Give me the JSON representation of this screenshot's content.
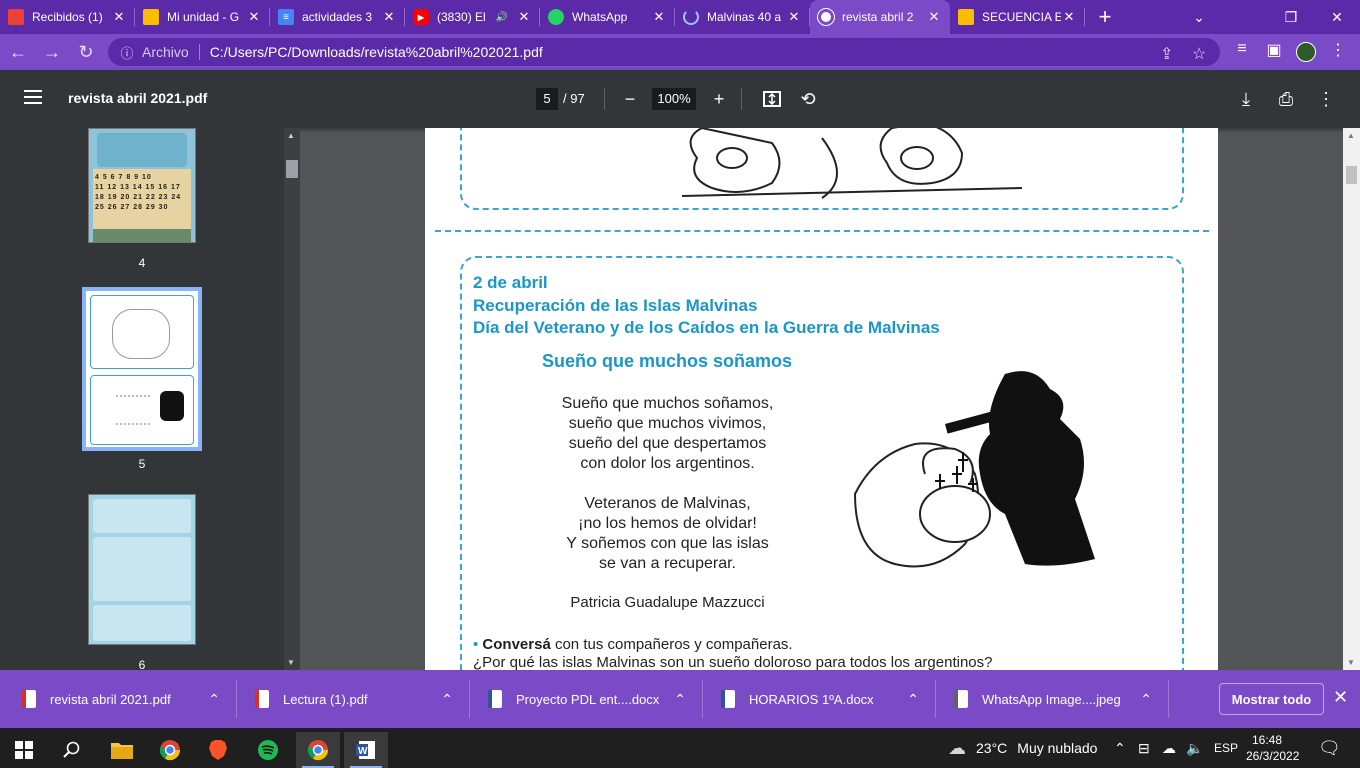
{
  "tabs": [
    {
      "label": "Recibidos (1)",
      "icon": "gmail-icon",
      "color": "#ea4335",
      "active": false
    },
    {
      "label": "Mi unidad - G",
      "icon": "drive-icon",
      "color": "#fbbc04",
      "active": false
    },
    {
      "label": "actividades 3",
      "icon": "docs-icon",
      "color": "#4285f4",
      "active": false
    },
    {
      "label": "(3830) El",
      "icon": "youtube-icon",
      "color": "#ff0000",
      "active": false
    },
    {
      "label": "WhatsApp",
      "icon": "whatsapp-icon",
      "color": "#25d366",
      "active": false
    },
    {
      "label": "Malvinas 40 a",
      "icon": "loading-icon",
      "color": "#9ec4ff",
      "active": false
    },
    {
      "label": "revista abril 2",
      "icon": "chrome-page-icon",
      "color": "#ffffff",
      "active": true
    },
    {
      "label": "SECUENCIA E",
      "icon": "drive-icon",
      "color": "#fbbc04",
      "active": false
    }
  ],
  "addressbar": {
    "protocol_label": "Archivo",
    "url": "C:/Users/PC/Downloads/revista%20abril%202021.pdf"
  },
  "pdf_toolbar": {
    "title": "revista abril 2021.pdf",
    "page_current": "5",
    "page_total": "/ 97",
    "zoom": "100%"
  },
  "thumbnails": [
    {
      "label": "4",
      "selected": false
    },
    {
      "label": "5",
      "selected": true
    },
    {
      "label": "6",
      "selected": false
    }
  ],
  "document": {
    "header": [
      "2 de abril",
      "Recuperación de las Islas Malvinas",
      "Día del Veterano y de los Caídos en la Guerra de Malvinas"
    ],
    "poem_title": "Sueño que muchos soñamos",
    "stanza1": [
      "Sueño que muchos soñamos,",
      "sueño que muchos vivimos,",
      "sueño del que despertamos",
      "con dolor los argentinos."
    ],
    "stanza2": [
      "Veteranos de Malvinas,",
      "¡no los hemos de olvidar!",
      "Y soñemos con que las islas",
      "se van a recuperar."
    ],
    "author": "Patricia Guadalupe Mazzucci",
    "question_bold": "Conversá",
    "question_rest": " con tus compañeros y compañeras.",
    "question2": "¿Por qué las islas Malvinas son un sueño doloroso para todos los argentinos?"
  },
  "downloads": [
    {
      "name": "revista abril 2021.pdf",
      "type": "pdf"
    },
    {
      "name": "Lectura  (1).pdf",
      "type": "pdf"
    },
    {
      "name": "Proyecto PDL ent....docx",
      "type": "docx"
    },
    {
      "name": "HORARIOS 1ºA.docx",
      "type": "docx"
    },
    {
      "name": "WhatsApp Image....jpeg",
      "type": "image"
    }
  ],
  "downloads_show_all": "Mostrar todo",
  "taskbar": {
    "weather_temp": "23°C",
    "weather_text": "Muy nublado",
    "language": "ESP",
    "time": "16:48",
    "date": "26/3/2022"
  },
  "colors": {
    "accent": "#7b4ac7",
    "accent_dark": "#5b2aa8",
    "doc_blue": "#1a97c9"
  }
}
